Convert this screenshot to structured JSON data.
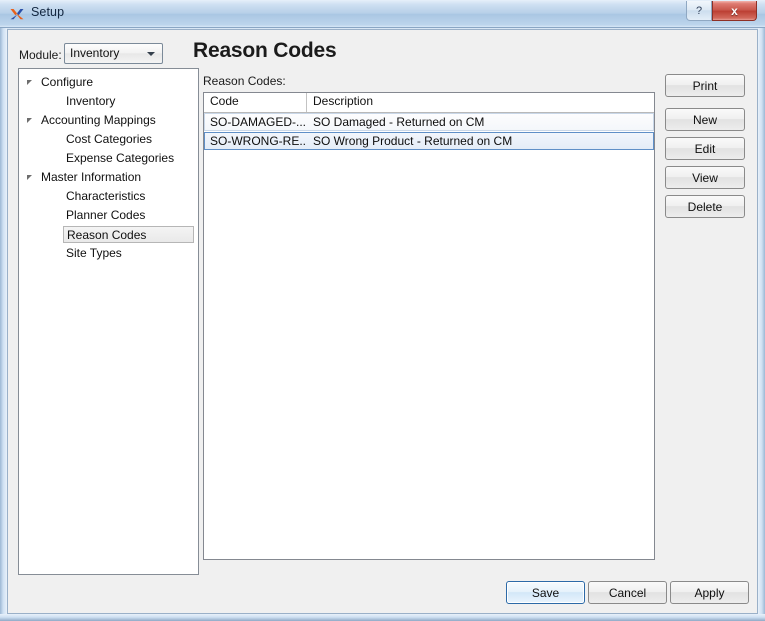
{
  "window": {
    "title": "Setup",
    "icon": "x-logo-icon",
    "help_label": "?",
    "close_label": "x"
  },
  "toolbar": {
    "module_label": "Module:",
    "module_value": "Inventory",
    "module_options": [
      "Inventory"
    ]
  },
  "page": {
    "title": "Reason Codes"
  },
  "tree": {
    "items": [
      {
        "label": "Configure",
        "level": 0,
        "expandable": true,
        "selected": false
      },
      {
        "label": "Inventory",
        "level": 1,
        "expandable": false,
        "selected": false
      },
      {
        "label": "Accounting Mappings",
        "level": 0,
        "expandable": true,
        "selected": false
      },
      {
        "label": "Cost Categories",
        "level": 1,
        "expandable": false,
        "selected": false
      },
      {
        "label": "Expense Categories",
        "level": 1,
        "expandable": false,
        "selected": false
      },
      {
        "label": "Master Information",
        "level": 0,
        "expandable": true,
        "selected": false
      },
      {
        "label": "Characteristics",
        "level": 1,
        "expandable": false,
        "selected": false
      },
      {
        "label": "Planner Codes",
        "level": 1,
        "expandable": false,
        "selected": false
      },
      {
        "label": "Reason Codes",
        "level": 1,
        "expandable": false,
        "selected": true
      },
      {
        "label": "Site Types",
        "level": 1,
        "expandable": false,
        "selected": false
      }
    ]
  },
  "list": {
    "caption": "Reason Codes:",
    "columns": [
      "Code",
      "Description"
    ],
    "rows": [
      {
        "code": "SO-DAMAGED-...",
        "description": "SO Damaged - Returned on CM",
        "selected": false
      },
      {
        "code": "SO-WRONG-RE...",
        "description": "SO Wrong Product -  Returned on CM",
        "selected": true
      }
    ]
  },
  "side_buttons": [
    {
      "label": "Print",
      "id": "btn-print"
    },
    {
      "label": "New",
      "id": "btn-new"
    },
    {
      "label": "Edit",
      "id": "btn-edit"
    },
    {
      "label": "View",
      "id": "btn-view"
    },
    {
      "label": "Delete",
      "id": "btn-delete"
    }
  ],
  "bottom_buttons": {
    "save": "Save",
    "cancel": "Cancel",
    "apply": "Apply"
  },
  "colors": {
    "titlebar_blue": "#b6cfe8",
    "close_red": "#c75348",
    "selection_blue": "#5f8fc7",
    "default_button_border": "#2c6aa8",
    "panel_gray": "#f0f0f0"
  }
}
